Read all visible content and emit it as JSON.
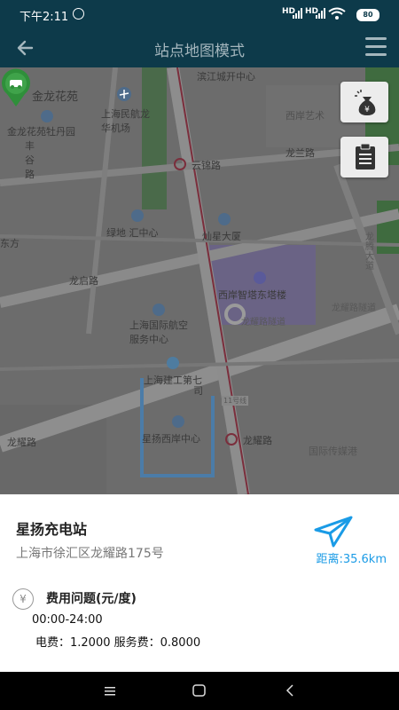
{
  "status_bar": {
    "time": "下午2:11",
    "signal_1": "HD",
    "signal_2": "HD",
    "battery": "80"
  },
  "header": {
    "title": "站点地图模式"
  },
  "map": {
    "labels": {
      "binjiang_city": "滨江城开中心",
      "jinlong_garden": "金龙花苑",
      "airport": "上海民航龙华机场",
      "west_bank_art": "西岸艺术",
      "peony_garden": "金龙花苑牡丹园",
      "fenggu_road": "丰谷路",
      "yunjin_road": "云锦路",
      "longlan_road": "龙兰路",
      "greenland_hui": "绿地 汇中心",
      "canshan_tower": "灿星大厦",
      "dongfang": "东方",
      "longteng_avenue": "龙腾大道",
      "longqi_road": "龙启路",
      "west_bank_tower": "西岸智塔东塔楼",
      "intl_aviation": "上海国际航空服务中心",
      "longyao_tunnel_1": "龙耀路隧道",
      "longyao_tunnel_2": "龙耀路隧道",
      "construction_7": "上海建工第七",
      "construction_si": "司",
      "line_11": "11号线",
      "longyao_road_left": "龙耀路",
      "xingyang_center": "星扬西岸中心",
      "longyao_road_right": "龙耀路",
      "intl_media_port": "国际传媒港"
    }
  },
  "station": {
    "name": "星扬充电站",
    "address": "上海市徐汇区龙耀路175号",
    "distance": "距离:35.6km"
  },
  "fee": {
    "yen_symbol": "¥",
    "title": "费用问题(元/度)",
    "time_range": "00:00-24:00",
    "detail": "电费：1.2000  服务费：0.8000"
  },
  "colors": {
    "header_bg": "#0d3a4a",
    "distance_blue": "#1a9be6",
    "pin_green": "#2f8f3a"
  }
}
